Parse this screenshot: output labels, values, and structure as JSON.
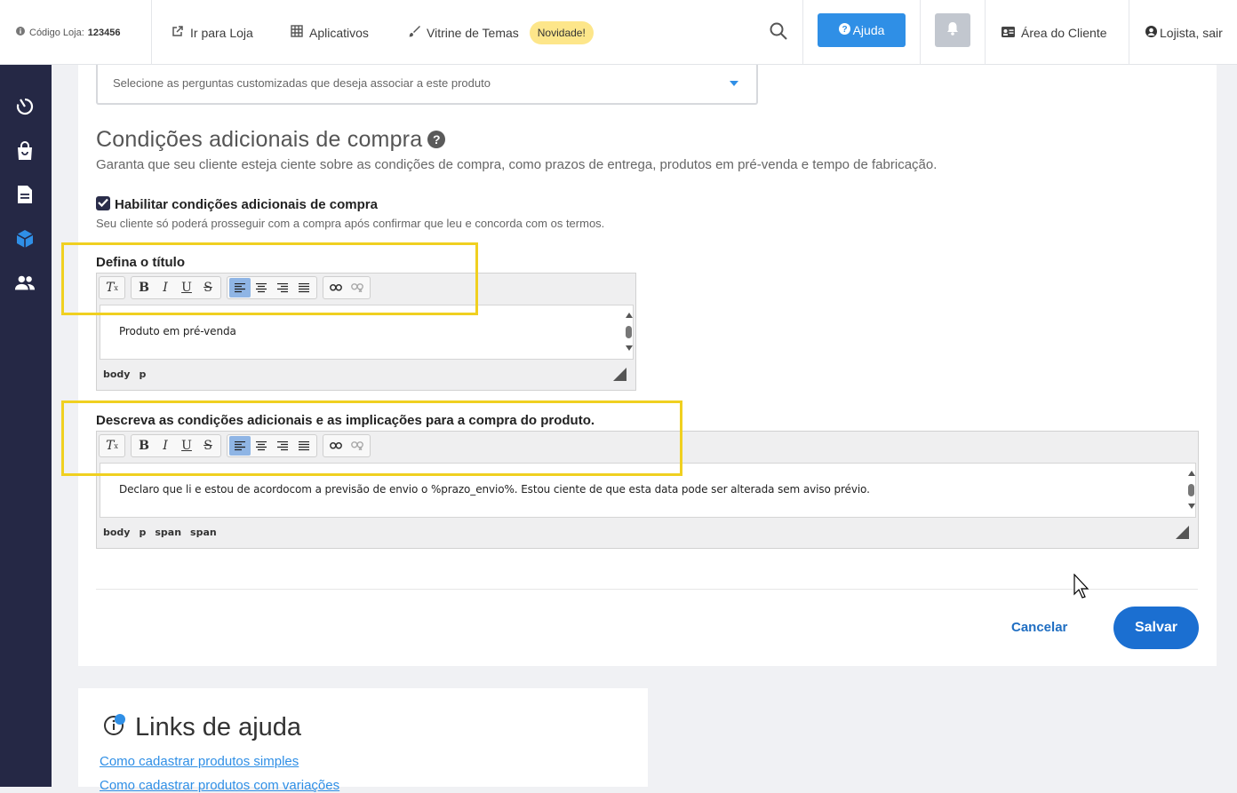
{
  "topbar": {
    "store_code_label": "Código Loja:",
    "store_code_value": "123456",
    "go_to_store": "Ir para Loja",
    "apps": "Aplicativos",
    "themes": "Vitrine de Temas",
    "new_badge": "Novidade!",
    "help": "Ajuda",
    "client_area": "Área do Cliente",
    "logout": "Lojista, sair"
  },
  "questions_select": {
    "placeholder": "Selecione as perguntas customizadas que deseja associar a este produto"
  },
  "section": {
    "title": "Condições adicionais de compra",
    "subtitle": "Garanta que seu cliente esteja ciente sobre as condições de compra, como prazos de entrega, produtos em pré-venda e tempo de fabricação.",
    "enable_label": "Habilitar condições adicionais de compra",
    "enable_checked": true,
    "enable_help": "Seu cliente só poderá prosseguir com a compra após confirmar que leu e concorda com os termos."
  },
  "title_editor": {
    "label": "Defina o título",
    "content": "Produto em pré-venda",
    "path": [
      "body",
      "p"
    ]
  },
  "conditions_editor": {
    "label": "Descreva as condições adicionais e as implicações para a compra do produto.",
    "content": "Declaro que li e estou de acordocom a previsão de envio o %prazo_envio%. Estou ciente de que esta data pode ser alterada sem aviso prévio.",
    "path": [
      "body",
      "p",
      "span",
      "span"
    ]
  },
  "actions": {
    "cancel": "Cancelar",
    "save": "Salvar"
  },
  "help_links": {
    "title": "Links de ajuda",
    "links": [
      "Como cadastrar produtos simples",
      "Como cadastrar produtos com variações"
    ]
  },
  "colors": {
    "sidebar": "#252845",
    "primary": "#2f8fe6",
    "save": "#1b6fd1",
    "highlight": "#f0d020",
    "badge": "#fde68a"
  }
}
